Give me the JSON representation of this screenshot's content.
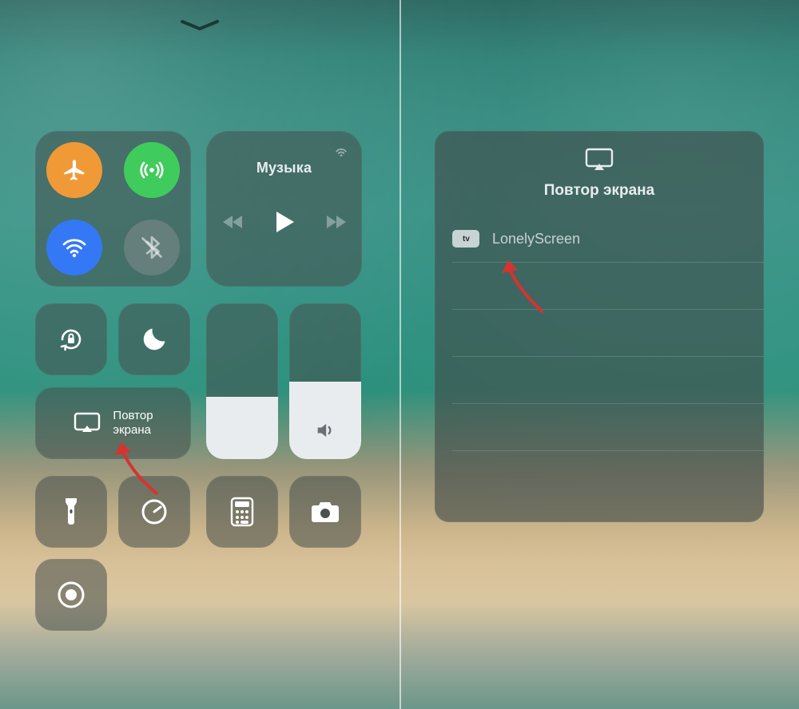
{
  "left": {
    "media_title": "Музыка",
    "screen_mirror_label": "Повтор\nэкрана",
    "brightness_percent": 40,
    "volume_percent": 50
  },
  "right": {
    "panel_title": "Повтор экрана",
    "device_tv_badge": "tv",
    "device_name": "LonelyScreen"
  }
}
